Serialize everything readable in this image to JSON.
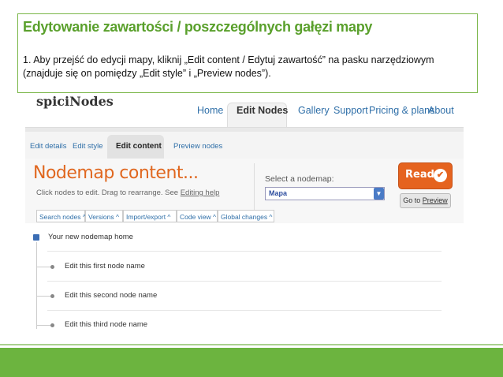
{
  "caption": {
    "title": "Edytowanie zawartości / poszczególnych gałęzi mapy",
    "body": "1. Aby przejść do edycji mapy, kliknij „Edit content / Edytuj zawartość” na pasku narzędziowym (znajduje się on pomiędzy „Edit style” i „Preview nodes”)."
  },
  "app": {
    "logo": "spiciNodes",
    "topnav": [
      "Home",
      "Edit Nodes",
      "Gallery",
      "Support",
      "Pricing & plans",
      "About"
    ],
    "topnav_active": "Edit Nodes",
    "subtabs": [
      "Edit details",
      "Edit style",
      "Edit content",
      "Preview nodes"
    ],
    "subtab_active": "Edit content"
  },
  "content": {
    "title": "Nodemap content...",
    "subtitle_prefix": "Click nodes to edit. Drag to rearrange. See ",
    "subtitle_link": "Editing help",
    "select_label": "Select a nodemap:",
    "select_value": "Mapa",
    "ready_label": "Ready",
    "goto_label_prefix": "Go to ",
    "goto_label_link": "Preview"
  },
  "toolbar": [
    "Search nodes ^",
    "Versions ^",
    "Import/export ^",
    "Code view ^",
    "Global changes ^"
  ],
  "tree": {
    "root": "Your new nodemap home",
    "nodes": [
      "Edit this first node name",
      "Edit this second node name",
      "Edit this third node name"
    ]
  },
  "colors": {
    "caption_title": "#5aa02c",
    "footer": "#6cb43f",
    "accent_orange": "#e5631f",
    "link_blue": "#2f6fa8"
  }
}
